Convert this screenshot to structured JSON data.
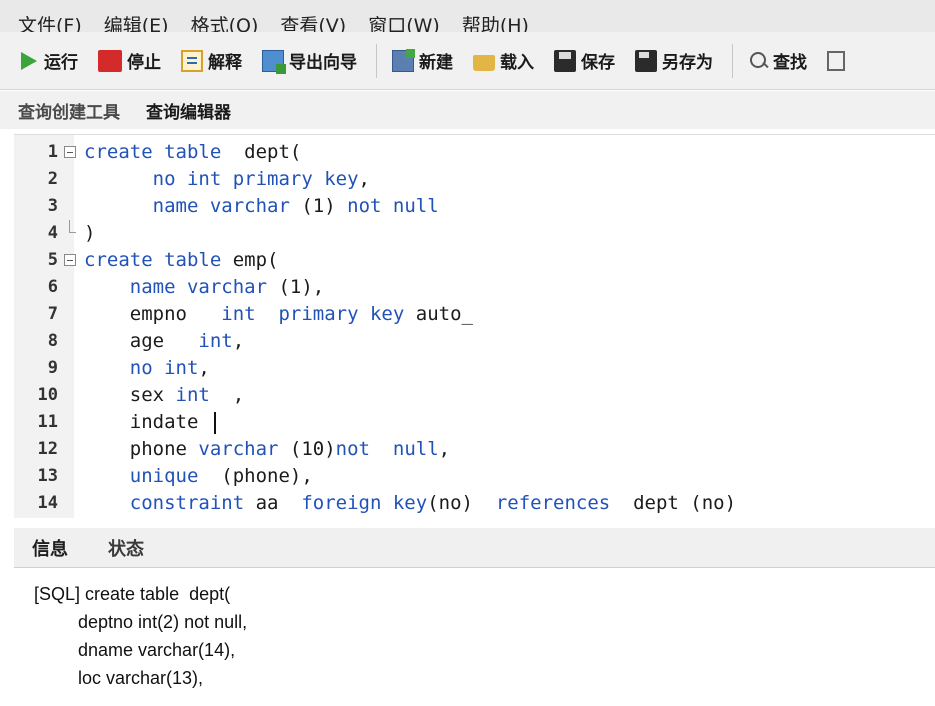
{
  "menu": [
    "文件(F)",
    "编辑(E)",
    "格式(O)",
    "查看(V)",
    "窗口(W)",
    "帮助(H)"
  ],
  "toolbar": {
    "run": "运行",
    "stop": "停止",
    "explain": "解释",
    "export_wizard": "导出向导",
    "new": "新建",
    "load": "载入",
    "save": "保存",
    "save_as": "另存为",
    "find": "查找"
  },
  "tabs": [
    "查询创建工具",
    "查询编辑器"
  ],
  "editor": {
    "lines": [
      {
        "n": "1",
        "tokens": [
          [
            "kw",
            "create table"
          ],
          [
            "tx",
            "  dept("
          ]
        ]
      },
      {
        "n": "2",
        "tokens": [
          [
            "tx",
            "      "
          ],
          [
            "kw",
            "no int primary key"
          ],
          [
            "tx",
            ","
          ]
        ]
      },
      {
        "n": "3",
        "tokens": [
          [
            "tx",
            "      "
          ],
          [
            "kw",
            "name varchar"
          ],
          [
            "tx",
            " (1) "
          ],
          [
            "kw",
            "not null"
          ]
        ]
      },
      {
        "n": "4",
        "tokens": [
          [
            "tx",
            ")"
          ]
        ]
      },
      {
        "n": "5",
        "tokens": [
          [
            "kw",
            "create table"
          ],
          [
            "tx",
            " emp("
          ]
        ]
      },
      {
        "n": "6",
        "tokens": [
          [
            "tx",
            "    "
          ],
          [
            "kw",
            "name varchar"
          ],
          [
            "tx",
            " (1),"
          ]
        ]
      },
      {
        "n": "7",
        "tokens": [
          [
            "tx",
            "    empno   "
          ],
          [
            "kw",
            "int  primary key"
          ],
          [
            "tx",
            " auto_"
          ]
        ]
      },
      {
        "n": "8",
        "tokens": [
          [
            "tx",
            "    age   "
          ],
          [
            "kw",
            "int"
          ],
          [
            "tx",
            ","
          ]
        ]
      },
      {
        "n": "9",
        "tokens": [
          [
            "tx",
            "    "
          ],
          [
            "kw",
            "no int"
          ],
          [
            "tx",
            ","
          ]
        ]
      },
      {
        "n": "10",
        "tokens": [
          [
            "tx",
            "    sex "
          ],
          [
            "kw",
            "int"
          ],
          [
            "tx",
            "  ,"
          ]
        ]
      },
      {
        "n": "11",
        "tokens": [
          [
            "tx",
            "    indate "
          ]
        ]
      },
      {
        "n": "12",
        "tokens": [
          [
            "tx",
            "    phone "
          ],
          [
            "kw",
            "varchar"
          ],
          [
            "tx",
            " (10)"
          ],
          [
            "kw",
            "not"
          ],
          [
            "tx",
            "  "
          ],
          [
            "kw",
            "null"
          ],
          [
            "tx",
            ","
          ]
        ]
      },
      {
        "n": "13",
        "tokens": [
          [
            "tx",
            "    "
          ],
          [
            "kw",
            "unique"
          ],
          [
            "tx",
            "  (phone),"
          ]
        ]
      },
      {
        "n": "14",
        "tokens": [
          [
            "tx",
            "    "
          ],
          [
            "kw",
            "constraint"
          ],
          [
            "tx",
            " aa  "
          ],
          [
            "kw",
            "foreign key"
          ],
          [
            "tx",
            "(no)  "
          ],
          [
            "kw",
            "references"
          ],
          [
            "tx",
            "  dept (no)"
          ]
        ]
      }
    ]
  },
  "panel_tabs": [
    "信息",
    "状态"
  ],
  "info_lines": [
    "[SQL] create table  dept(",
    "deptno int(2) not null,",
    "dname varchar(14),",
    "loc varchar(13),"
  ]
}
